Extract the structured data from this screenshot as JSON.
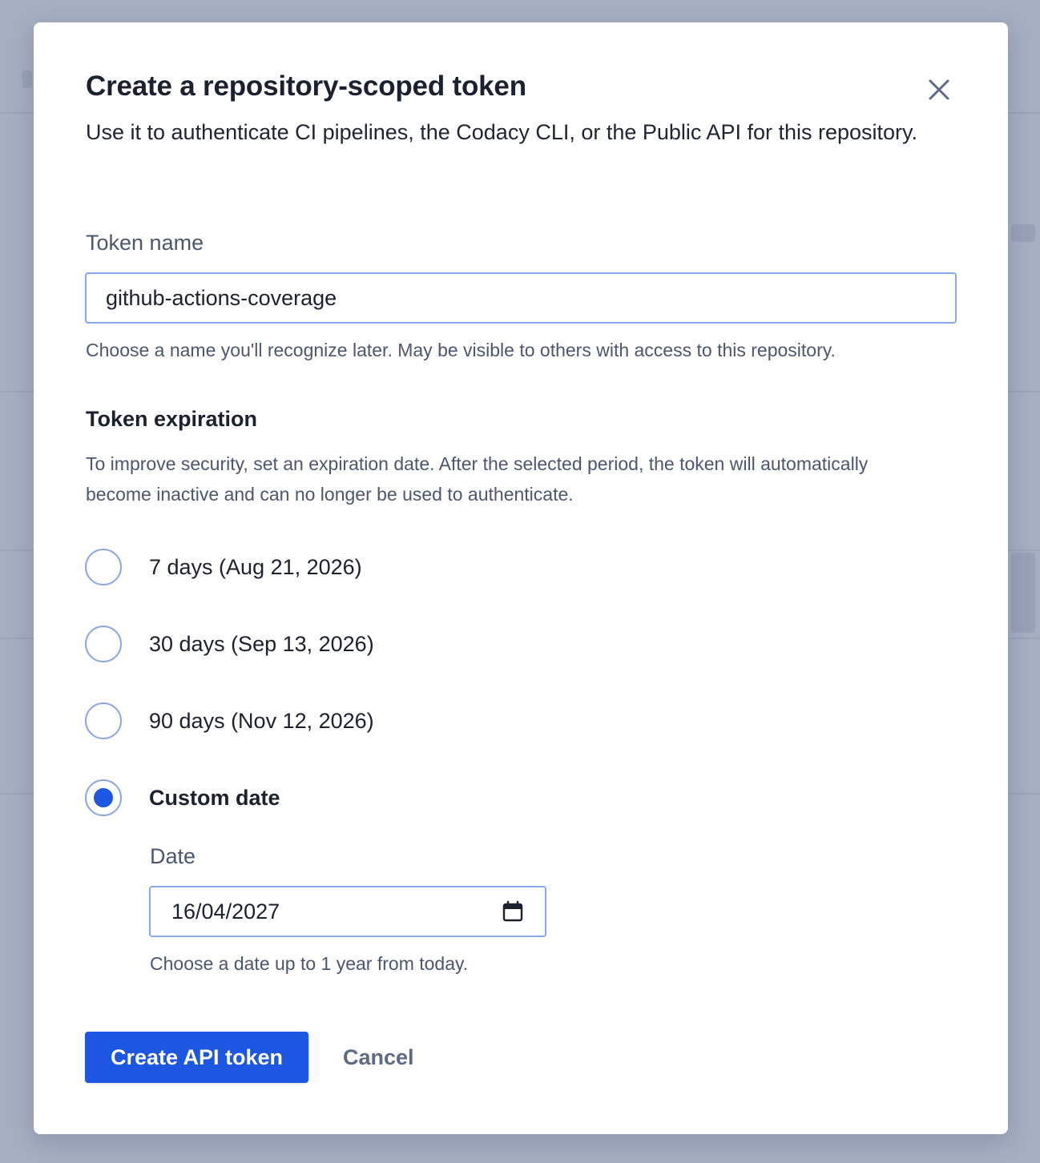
{
  "modal": {
    "title": "Create a repository-scoped token",
    "subtitle": "Use it to authenticate CI pipelines, the Codacy CLI, or the Public API for this repository.",
    "close_icon": "close-icon"
  },
  "token_name": {
    "label": "Token name",
    "value": "github-actions-coverage",
    "help": "Choose a name you'll recognize later. May be visible to others with access to this repository."
  },
  "expiration": {
    "title": "Token expiration",
    "description": "To improve security, set an expiration date. After the selected period, the token will automatically become inactive and can no longer be used to authenticate.",
    "options": [
      {
        "label": "7 days (Aug 21, 2026)",
        "selected": false
      },
      {
        "label": "30 days (Sep 13, 2026)",
        "selected": false
      },
      {
        "label": "90 days (Nov 12, 2026)",
        "selected": false
      },
      {
        "label": "Custom date",
        "selected": true
      }
    ]
  },
  "custom_date": {
    "label": "Date",
    "value": "16/04/2027",
    "calendar_icon": "calendar-icon",
    "help": "Choose a date up to 1 year from today."
  },
  "actions": {
    "create_label": "Create API token",
    "cancel_label": "Cancel"
  },
  "colors": {
    "primary": "#1d56e0",
    "input_border": "#8aa8f0",
    "backdrop": "#a6aec2"
  }
}
